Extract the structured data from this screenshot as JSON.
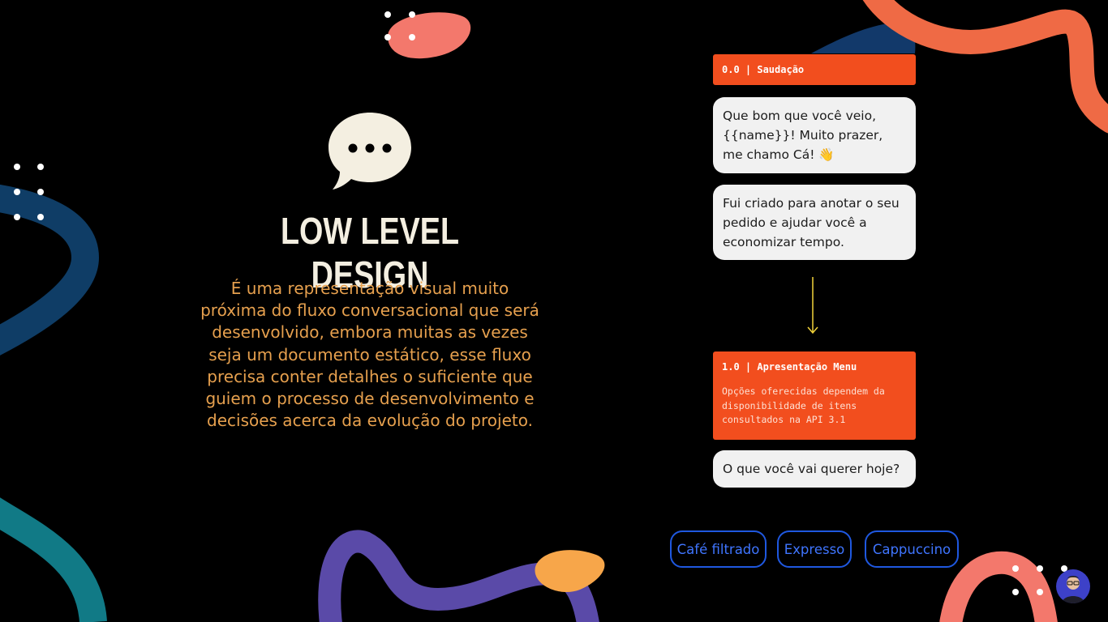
{
  "slide": {
    "title": "LOW LEVEL DESIGN",
    "description": "É uma representação visual muito próxima do fluxo conversacional que será desenvolvido, embora muitas as vezes seja um documento estático, esse fluxo precisa conter detalhes o suficiente que guiem o processo de desenvolvimento e decisões acerca da evolução do projeto.",
    "icon": "speech-bubble-icon"
  },
  "flow": {
    "node1": {
      "label": "0.0 | Saudação",
      "messages": [
        "Que bom que você veio, {{name}}! Muito prazer, me chamo Cá! 👋",
        "Fui criado para anotar o seu pedido e ajudar você a economizar tempo."
      ]
    },
    "node2": {
      "label": "1.0 | Apresentação Menu",
      "note": "Opções oferecidas dependem da disponibilidade de itens consultados na API 3.1",
      "message": "O que você vai querer hoje?"
    },
    "options": [
      "Café filtrado",
      "Expresso",
      "Cappuccino"
    ]
  },
  "colors": {
    "background": "#000000",
    "title": "#f4efe1",
    "description": "#e6a04e",
    "node_header": "#f24e1e",
    "bubble": "#f1f1f1",
    "option_border": "#1f58e0",
    "arrow": "#f2d33a"
  }
}
